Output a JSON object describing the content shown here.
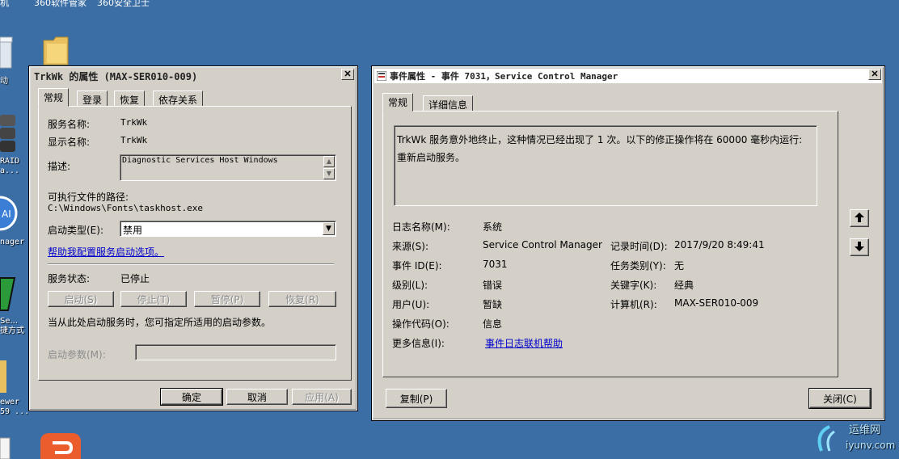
{
  "desktop": {
    "top_labels": [
      "机",
      "360软件管家",
      "360安全卫士"
    ],
    "icon_labels": {
      "label1": "动",
      "label2a": "RAID",
      "label2b": "a...",
      "label3": "nager",
      "label4a": "Se...",
      "label4b": "捷方式",
      "label5a": "ewer",
      "label5b": "59 ..."
    },
    "watermark": {
      "title": "运维网",
      "url": "iyunv.com"
    }
  },
  "props": {
    "title": "TrkWk 的属性 (MAX-SER010-009)",
    "tabs": [
      "常规",
      "登录",
      "恢复",
      "依存关系"
    ],
    "service_name_label": "服务名称:",
    "service_name": "TrkWk",
    "display_name_label": "显示名称:",
    "display_name": "TrkWk",
    "desc_label": "描述:",
    "desc": "Diagnostic Services Host Windows",
    "path_label": "可执行文件的路径:",
    "path": "C:\\Windows\\Fonts\\taskhost.exe",
    "startup_label": "启动类型(E):",
    "startup_value": "禁用",
    "help_link": "帮助我配置服务启动选项。",
    "status_label": "服务状态:",
    "status_value": "已停止",
    "btn_start": "启动(S)",
    "btn_stop": "停止(T)",
    "btn_pause": "暂停(P)",
    "btn_resume": "恢复(R)",
    "start_hint": "当从此处启动服务时，您可指定所适用的启动参数。",
    "params_label": "启动参数(M):",
    "params_value": "",
    "btn_ok": "确定",
    "btn_cancel": "取消",
    "btn_apply": "应用(A)"
  },
  "event": {
    "title": "事件属性 - 事件 7031，Service Control Manager",
    "tabs": [
      "常规",
      "详细信息"
    ],
    "message": "TrkWk 服务意外地终止，这种情况已经出现了 1 次。以下的修正操作将在 60000 毫秒内运行: 重新启动服务。",
    "log_name_label": "日志名称(M):",
    "log_name": "系统",
    "source_label": "来源(S):",
    "source": "Service Control Manager",
    "logged_label": "记录时间(D):",
    "logged": "2017/9/20 8:49:41",
    "event_id_label": "事件 ID(E):",
    "event_id": "7031",
    "task_label": "任务类别(Y):",
    "task": "无",
    "level_label": "级别(L):",
    "level": "错误",
    "keywords_label": "关键字(K):",
    "keywords": "经典",
    "user_label": "用户(U):",
    "user": "暂缺",
    "computer_label": "计算机(R):",
    "computer": "MAX-SER010-009",
    "opcode_label": "操作代码(O):",
    "opcode": "信息",
    "more_label": "更多信息(I):",
    "more_link": "事件日志联机帮助",
    "btn_copy": "复制(P)",
    "btn_close": "关闭(C)"
  }
}
